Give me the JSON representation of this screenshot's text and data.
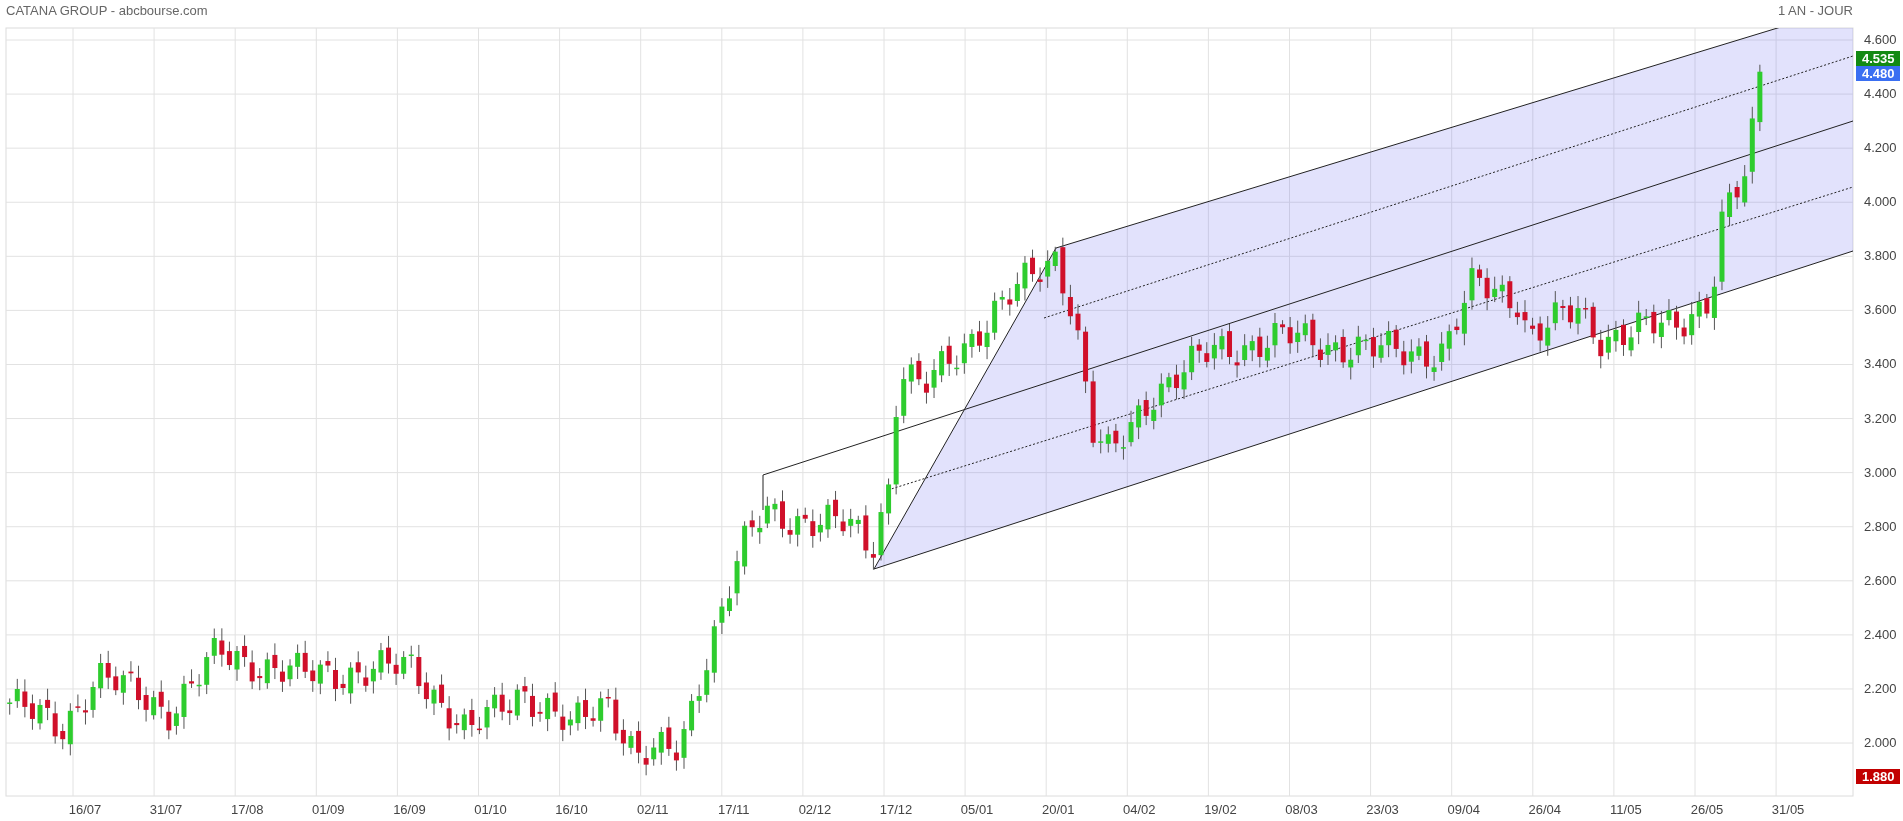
{
  "header": {
    "title": "CATANA GROUP - abcbourse.com",
    "period": "1 AN - JOUR"
  },
  "y_axis": [
    "4.600",
    "4.400",
    "4.200",
    "4.000",
    "3.800",
    "3.600",
    "3.400",
    "3.200",
    "3.000",
    "2.800",
    "2.600",
    "2.400",
    "2.200",
    "2.000"
  ],
  "x_axis": [
    "16/07",
    "31/07",
    "17/08",
    "01/09",
    "16/09",
    "01/10",
    "16/10",
    "02/11",
    "17/11",
    "02/12",
    "17/12",
    "05/01",
    "20/01",
    "04/02",
    "19/02",
    "08/03",
    "23/03",
    "09/04",
    "26/04",
    "11/05",
    "26/05",
    "31/05"
  ],
  "price_tags": [
    {
      "text": "4.535",
      "color": "#138a13"
    },
    {
      "text": "4.480",
      "color": "#3a6ff2"
    },
    {
      "text": "1.880",
      "color": "#c20000"
    }
  ]
}
